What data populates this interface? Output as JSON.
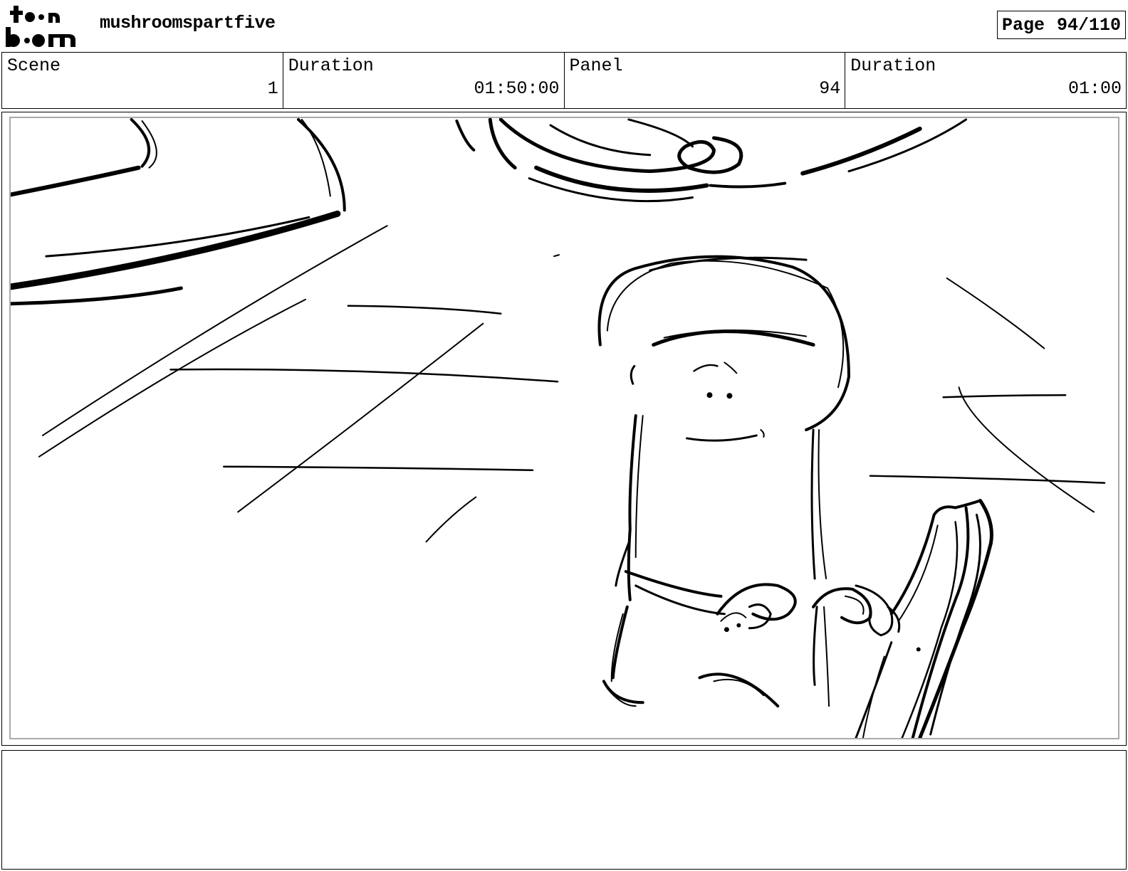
{
  "header": {
    "logo_top": "toon",
    "logo_bottom": "boom",
    "project_title": "mushroomspartfive",
    "page_label": "Page",
    "page_value": "94/110"
  },
  "info": {
    "scene_label": "Scene",
    "scene_value": "1",
    "scene_duration_label": "Duration",
    "scene_duration_value": "01:50:00",
    "panel_label": "Panel",
    "panel_value": "94",
    "panel_duration_label": "Duration",
    "panel_duration_value": "01:00"
  },
  "notes": {
    "text": ""
  }
}
